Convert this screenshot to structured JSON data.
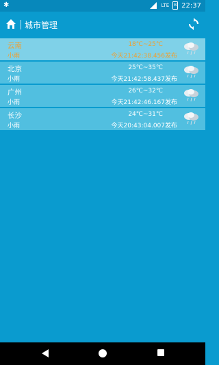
{
  "status_bar": {
    "left_icon": "notification-star-icon",
    "network_label": "LTE",
    "battery_label": "B",
    "time": "22:37"
  },
  "app_bar": {
    "title": "城市管理",
    "home_icon": "home-icon",
    "refresh_icon": "refresh-icon"
  },
  "cities": [
    {
      "name": "云南",
      "weather": "小雨",
      "temp": "18℃~25℃",
      "updated": "今天21:42:38.456发布",
      "highlight": true
    },
    {
      "name": "北京",
      "weather": "小雨",
      "temp": "25℃~35℃",
      "updated": "今天21:42:58.437发布",
      "highlight": false
    },
    {
      "name": "广州",
      "weather": "小雨",
      "temp": "26℃~32℃",
      "updated": "今天21:42:46.167发布",
      "highlight": false
    },
    {
      "name": "长沙",
      "weather": "小雨",
      "temp": "24℃~31℃",
      "updated": "今天20:43:04.007发布",
      "highlight": false
    }
  ],
  "colors": {
    "background": "#0a9bcf",
    "row": "#51bfe0",
    "row_highlight": "#7fd1e8",
    "highlight_text": "#f0a030"
  }
}
